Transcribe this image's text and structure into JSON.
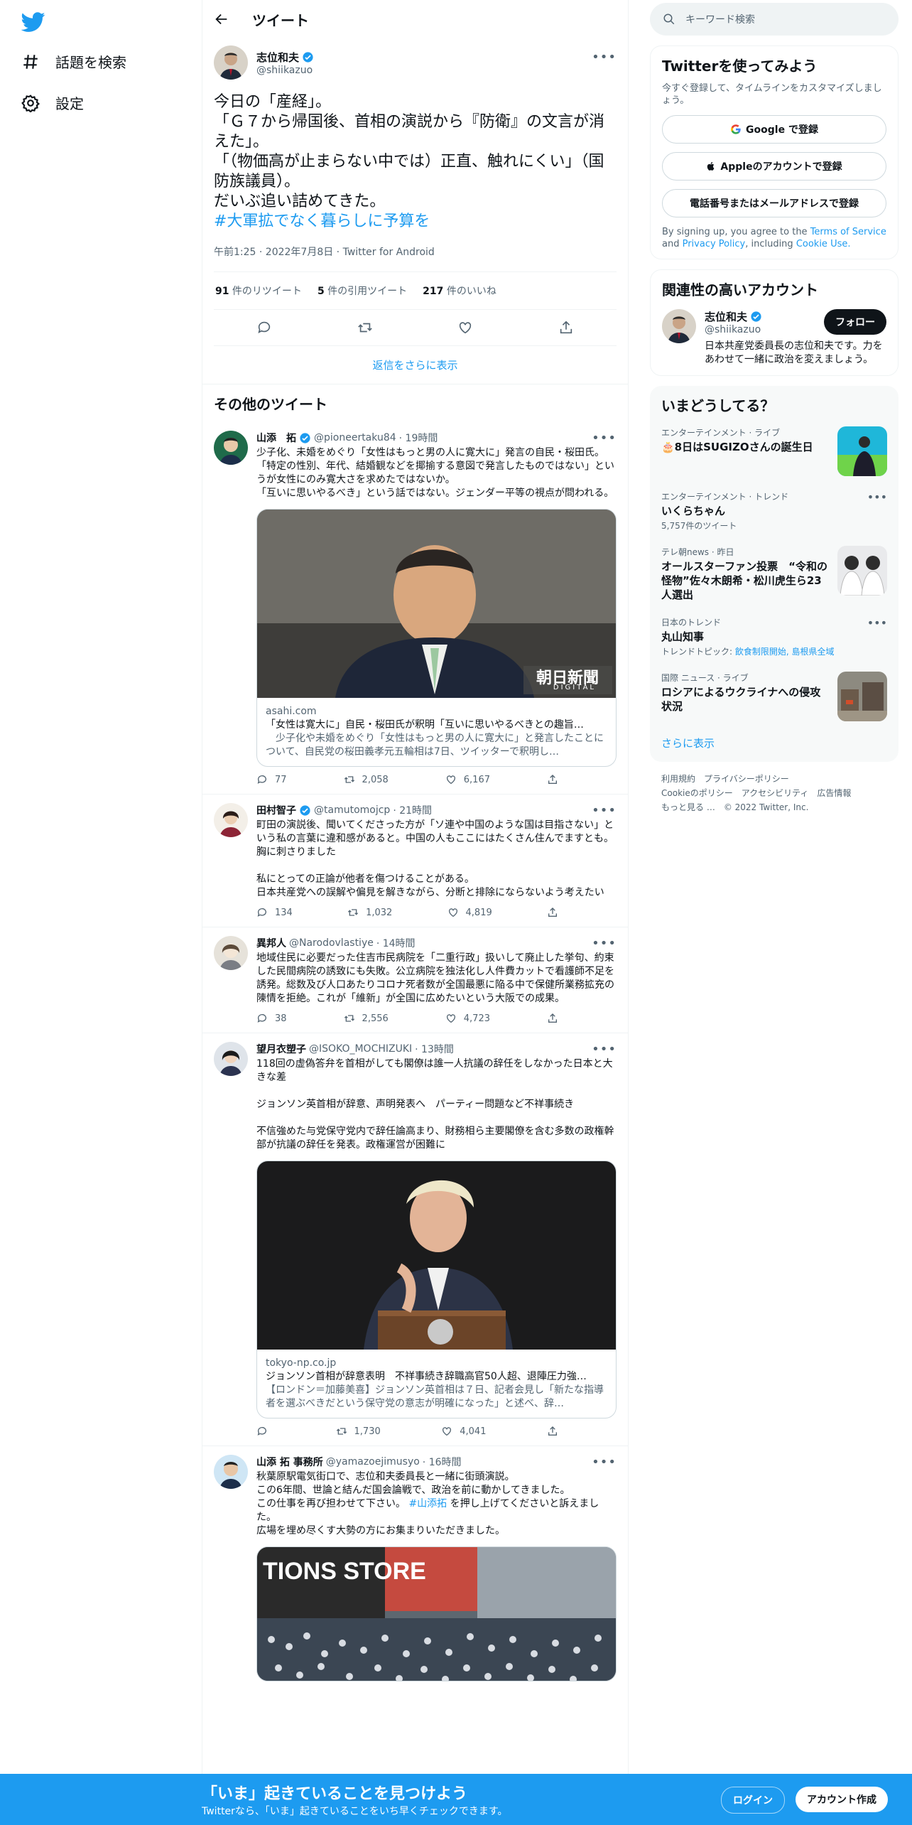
{
  "nav": {
    "explore_label": "話題を検索",
    "settings_label": "設定"
  },
  "header": {
    "title": "ツイート"
  },
  "focus_tweet": {
    "name": "志位和夫",
    "handle": "@shiikazuo",
    "text": "今日の「産経」。\n「Ｇ７から帰国後、首相の演説から『防衛』の文言が消えた」。\n「（物価高が止まらない中では）正直、触れにくい」（国防族議員）。\nだいぶ追い詰めてきた。",
    "hashtag": "#大軍拡でなく暮らしに予算を",
    "meta": "午前1:25 · 2022年7月8日 · Twitter for Android",
    "retweets_num": "91",
    "retweets_label": " 件のリツイート",
    "quotes_num": "5",
    "quotes_label": " 件の引用ツイート",
    "likes_num": "217",
    "likes_label": " 件のいいね",
    "show_more": "返信をさらに表示"
  },
  "other_title": "その他のツイート",
  "tweets": [
    {
      "name": "山添　拓",
      "handle": "@pioneertaku84",
      "time": "· 19時間",
      "text": "少子化、未婚をめぐり「女性はもっと男の人に寛大に」発言の自民・桜田氏。\n「特定の性別、年代、結婚観などを揶揄する意図で発言したものではない」というが女性にのみ寛大さを求めたではないか。\n「互いに思いやるべき」という話ではない。ジェンダー平等の視点が問われる。",
      "card_domain": "asahi.com",
      "card_title": "「女性は寛大に」自民・桜田氏が釈明「互いに思いやるべきとの趣旨…",
      "card_desc": "　少子化や未婚をめぐり「女性はもっと男の人に寛大に」と発言したことについて、自民党の桜田義孝元五輪相は7日、ツイッターで釈明し…",
      "card_logo": "朝日新聞",
      "card_logo_sub": "DIGITAL",
      "replies": "77",
      "retweets": "2,058",
      "likes": "6,167"
    },
    {
      "name": "田村智子",
      "handle": "@tamutomojcp",
      "time": "· 21時間",
      "text": "町田の演説後、聞いてくださった方が「ソ連や中国のような国は目指さない」という私の言葉に違和感があると。中国の人もここにはたくさん住んでますとも。胸に刺さりました\n\n私にとっての正論が他者を傷つけることがある。\n日本共産党への誤解や偏見を解きながら、分断と排除にならないよう考えたい",
      "replies": "134",
      "retweets": "1,032",
      "likes": "4,819"
    },
    {
      "name": "異邦人",
      "handle": "@Narodovlastiye",
      "time": "· 14時間",
      "text": "地域住民に必要だった住吉市民病院を「二重行政」扱いして廃止した挙句、約束した民間病院の誘致にも失敗。公立病院を独法化し人件費カットで看護師不足を誘発。総数及び人口あたりコロナ死者数が全国最悪に陥る中で保健所業務拡充の陳情を拒絶。これが「維新」が全国に広めたいという大阪での成果。",
      "replies": "38",
      "retweets": "2,556",
      "likes": "4,723"
    },
    {
      "name": "望月衣塑子",
      "handle": "@ISOKO_MOCHIZUKI",
      "time": "· 13時間",
      "text": "118回の虚偽答弁を首相がしても閣僚は誰一人抗議の辞任をしなかった日本と大きな差\n\nジョンソン英首相が辞意、声明発表へ　パーティー問題など不祥事続き\n\n不信強めた与党保守党内で辞任論高まり、財務相ら主要閣僚を含む多数の政権幹部が抗議の辞任を発表。政権運営が困難に",
      "card_domain": "tokyo-np.co.jp",
      "card_title": "ジョンソン首相が辞意表明　不祥事続き辞職高官50人超、退陣圧力強…",
      "card_desc": "【ロンドン＝加藤美喜】ジョンソン英首相は７日、記者会見し「新たな指導者を選ぶべきだという保守党の意志が明確になった」と述べ、辞…",
      "replies": "",
      "retweets": "1,730",
      "likes": "4,041"
    },
    {
      "name": "山添 拓 事務所",
      "handle": "@yamazoejimusyo",
      "time": "· 16時間",
      "text_before": "秋葉原駅電気街口で、志位和夫委員長と一緒に街頭演説。\nこの6年間、世論と結んだ国会論戦で、政治を前に動かしてきました。\nこの仕事を再び担わせて下さい。 ",
      "hashtag": "#山添拓",
      "text_after": " を押し上げてくださいと訴えました。\n広場を埋め尽くす大勢の方にお集まりいただきました。",
      "card_sign": "TIONS STORE"
    }
  ],
  "right": {
    "search_placeholder": "キーワード検索",
    "signup_title": "Twitterを使ってみよう",
    "signup_sub": "今すぐ登録して、タイムラインをカスタマイズしましょう。",
    "google_btn": "Google で登録",
    "apple_btn": "Appleのアカウントで登録",
    "phone_btn": "電話番号またはメールアドレスで登録",
    "terms_before": "By signing up, you agree to the ",
    "terms_link1": "Terms of Service",
    "terms_mid": " and ",
    "terms_link2": "Privacy Policy",
    "terms_mid2": ", including ",
    "terms_link3": "Cookie Use.",
    "related_title": "関連性の高いアカウント",
    "related_name": "志位和夫",
    "related_handle": "@shiikazuo",
    "related_bio": "日本共産党委員長の志位和夫です。力をあわせて一緒に政治を変えましょう。",
    "follow_label": "フォロー",
    "trends_title": "いまどうしてる？",
    "trends": [
      {
        "cat": "エンターテインメント · ライブ",
        "ttl": "🎂8日はSUGIZOさんの誕生日",
        "sub": ""
      },
      {
        "cat": "エンターテインメント · トレンド",
        "ttl": "いくらちゃん",
        "sub": "5,757件のツイート"
      },
      {
        "cat": "テレ朝news · 昨日",
        "ttl": "オールスターファン投票　“令和の怪物”佐々木朗希・松川虎生ら23人選出",
        "sub": ""
      },
      {
        "cat": "日本のトレンド",
        "ttl": "丸山知事",
        "sub_prefix": "トレンドトピック: ",
        "sub_link": "飲食制限開始, 島根県全域"
      },
      {
        "cat": "国際 ニュース · ライブ",
        "ttl": "ロシアによるウクライナへの侵攻状況",
        "sub": ""
      }
    ],
    "show_more": "さらに表示",
    "footer": [
      "利用規約",
      "プライバシーポリシー",
      "Cookieのポリシー",
      "アクセシビリティ",
      "広告情報",
      "もっと見る …",
      "© 2022 Twitter, Inc."
    ]
  },
  "bottom": {
    "title": "「いま」起きていることを見つけよう",
    "sub": "Twitterなら、「いま」起きていることをいち早くチェックできます。",
    "login": "ログイン",
    "signup": "アカウント作成"
  },
  "colors": {
    "brand": "#1d9bf0",
    "text": "#0f1419",
    "muted": "#536471"
  }
}
